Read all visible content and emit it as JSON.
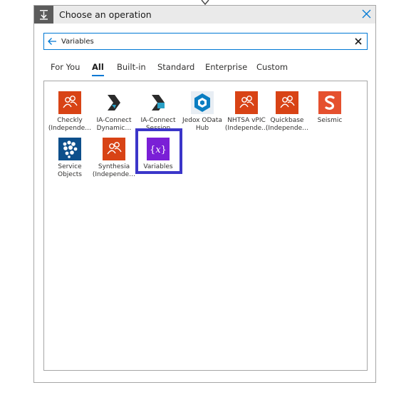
{
  "panel": {
    "title": "Choose an operation"
  },
  "search": {
    "value": "Variables",
    "placeholder": ""
  },
  "tabs": [
    {
      "label": "For You"
    },
    {
      "label": "All",
      "active": true
    },
    {
      "label": "Built-in"
    },
    {
      "label": "Standard"
    },
    {
      "label": "Enterprise"
    },
    {
      "label": "Custom"
    }
  ],
  "connectors": [
    {
      "line1": "Checkly",
      "line2": "(Independe…",
      "icon": "people-icon",
      "color": "#d84315"
    },
    {
      "line1": "IA-Connect",
      "line2": "Dynamic…",
      "icon": "ia-connect-dynamics-icon",
      "color": "#2b2b2b"
    },
    {
      "line1": "IA-Connect",
      "line2": "Session",
      "icon": "ia-connect-session-icon",
      "color": "#2b2b2b"
    },
    {
      "line1": "Jedox OData",
      "line2": "Hub",
      "icon": "jedox-hexagon-icon",
      "color": "#0a7ec2"
    },
    {
      "line1": "NHTSA vPIC",
      "line2": "(Independe…",
      "icon": "people-icon",
      "color": "#d84315"
    },
    {
      "line1": "Quickbase",
      "line2": "(Independe…",
      "icon": "people-icon",
      "color": "#d84315"
    },
    {
      "line1": "Seismic",
      "line2": "",
      "icon": "seismic-s-icon",
      "color": "#e5502e"
    },
    {
      "line1": "Service",
      "line2": "Objects",
      "icon": "service-objects-dots-icon",
      "color": "#0d4f8b"
    },
    {
      "line1": "Synthesia",
      "line2": "(Independe…",
      "icon": "people-icon",
      "color": "#d84315"
    },
    {
      "line1": "Variables",
      "line2": "",
      "icon": "curly-braces-x-icon",
      "color": "#7a1fd6"
    }
  ]
}
